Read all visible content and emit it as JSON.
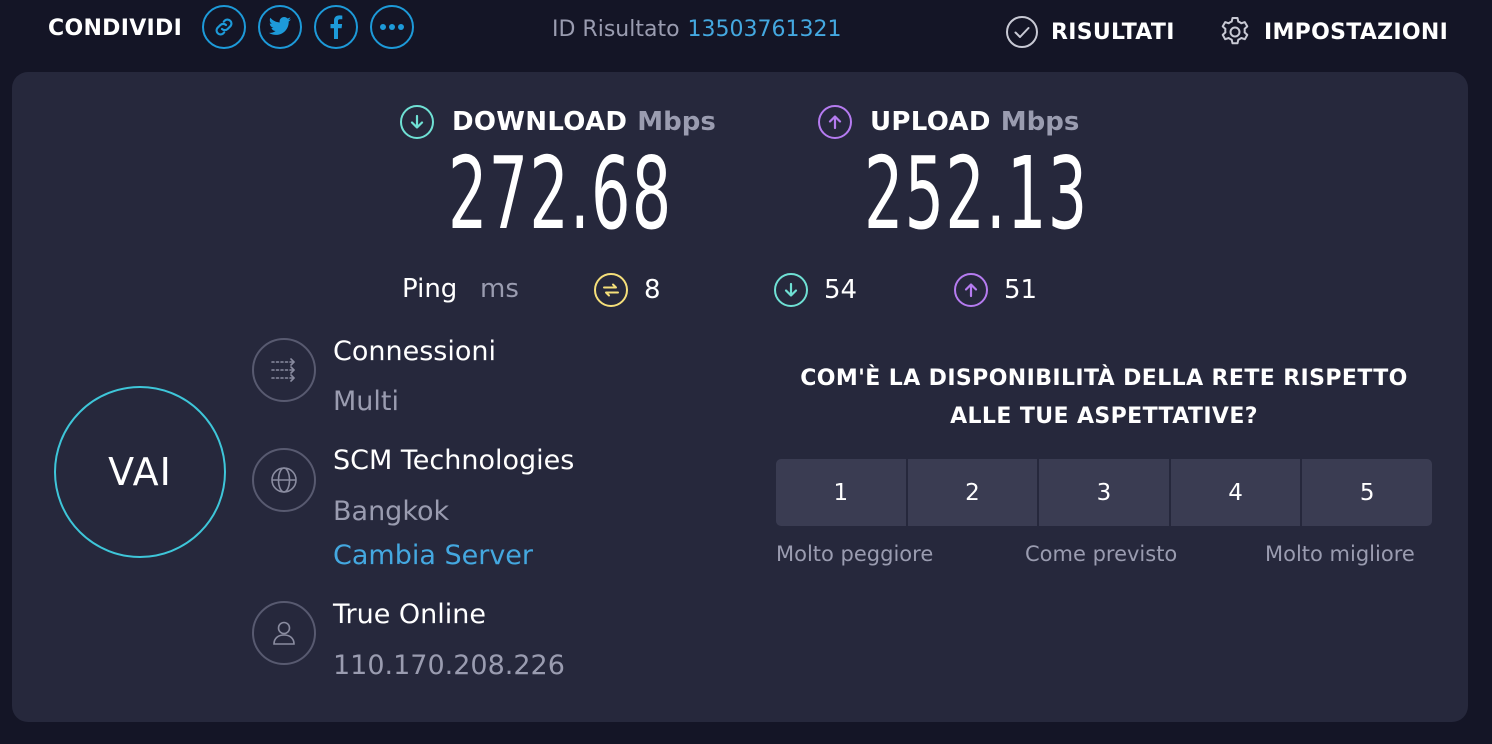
{
  "header": {
    "share_label": "CONDIVIDI",
    "share_icons": [
      "link-icon",
      "twitter-icon",
      "facebook-icon",
      "more-icon"
    ],
    "result_id_label": "ID Risultato",
    "result_id_value": "13503761321",
    "results_label": "RISULTATI",
    "settings_label": "IMPOSTAZIONI"
  },
  "download": {
    "label": "DOWNLOAD",
    "unit": "Mbps",
    "value": "272.68"
  },
  "upload": {
    "label": "UPLOAD",
    "unit": "Mbps",
    "value": "252.13"
  },
  "ping": {
    "label": "Ping",
    "unit": "ms",
    "idle": "8",
    "download": "54",
    "upload": "51"
  },
  "go_label": "VAI",
  "connections": {
    "title": "Connessioni",
    "value": "Multi"
  },
  "server": {
    "name": "SCM Technologies",
    "location": "Bangkok",
    "change_link": "Cambia Server"
  },
  "provider": {
    "name": "True Online",
    "ip": "110.170.208.226"
  },
  "rating": {
    "question": "COM'È LA DISPONIBILITÀ DELLA RETE RISPETTO ALLE TUE ASPETTATIVE?",
    "options": [
      "1",
      "2",
      "3",
      "4",
      "5"
    ],
    "caption_low": "Molto peggiore",
    "caption_mid": "Come previsto",
    "caption_high": "Molto migliore"
  },
  "colors": {
    "background": "#141526",
    "card": "#26283c",
    "accent_blue": "#1d9ad9",
    "download": "#6fe0d4",
    "upload": "#b57bf0",
    "ping": "#f5df7a"
  }
}
